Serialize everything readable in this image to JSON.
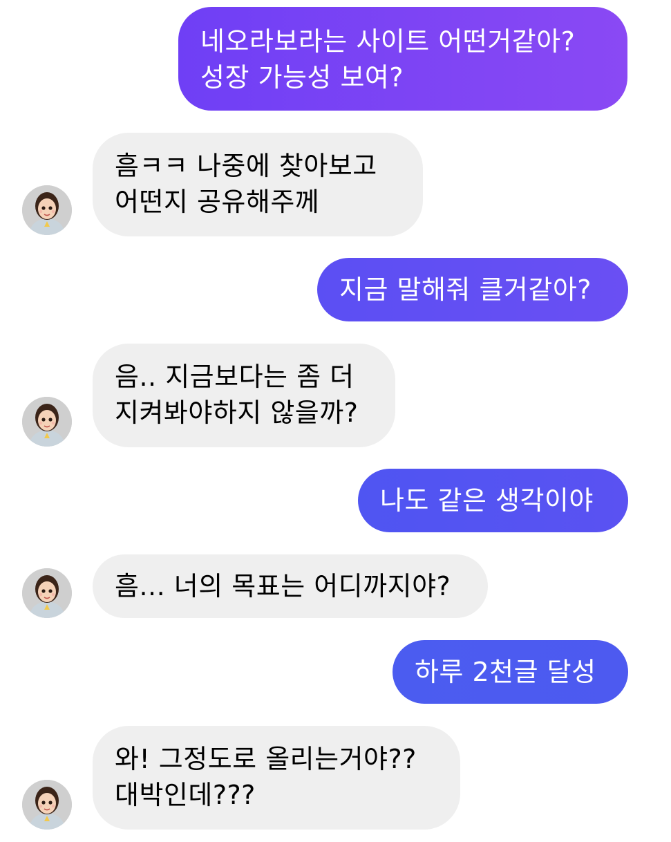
{
  "chat": {
    "messages": [
      {
        "sender": "me",
        "lines": [
          "네오라보라는 사이트 어떤거같아?",
          "성장 가능성 보여?"
        ]
      },
      {
        "sender": "them",
        "lines": [
          "흠ㅋㅋ 나중에 찾아보고",
          "어떤지 공유해주께"
        ]
      },
      {
        "sender": "me",
        "lines": [
          "지금 말해줘 클거같아?"
        ]
      },
      {
        "sender": "them",
        "lines": [
          "음.. 지금보다는 좀 더",
          "지켜봐야하지 않을까?"
        ]
      },
      {
        "sender": "me",
        "lines": [
          "나도 같은 생각이야"
        ]
      },
      {
        "sender": "them",
        "lines": [
          "흠... 너의 목표는 어디까지야?"
        ]
      },
      {
        "sender": "me",
        "lines": [
          "하루 2천글 달성"
        ]
      },
      {
        "sender": "them",
        "lines": [
          "와! 그정도로 올리는거야??",
          "대박인데???"
        ]
      }
    ]
  },
  "colors": {
    "outgoing_gradient_top": "#7a46f2",
    "outgoing_gradient_bottom": "#4a5cf0",
    "incoming_bubble": "#efefef"
  },
  "icons": {
    "avatar": "profile-avatar-illustrated-girl"
  }
}
